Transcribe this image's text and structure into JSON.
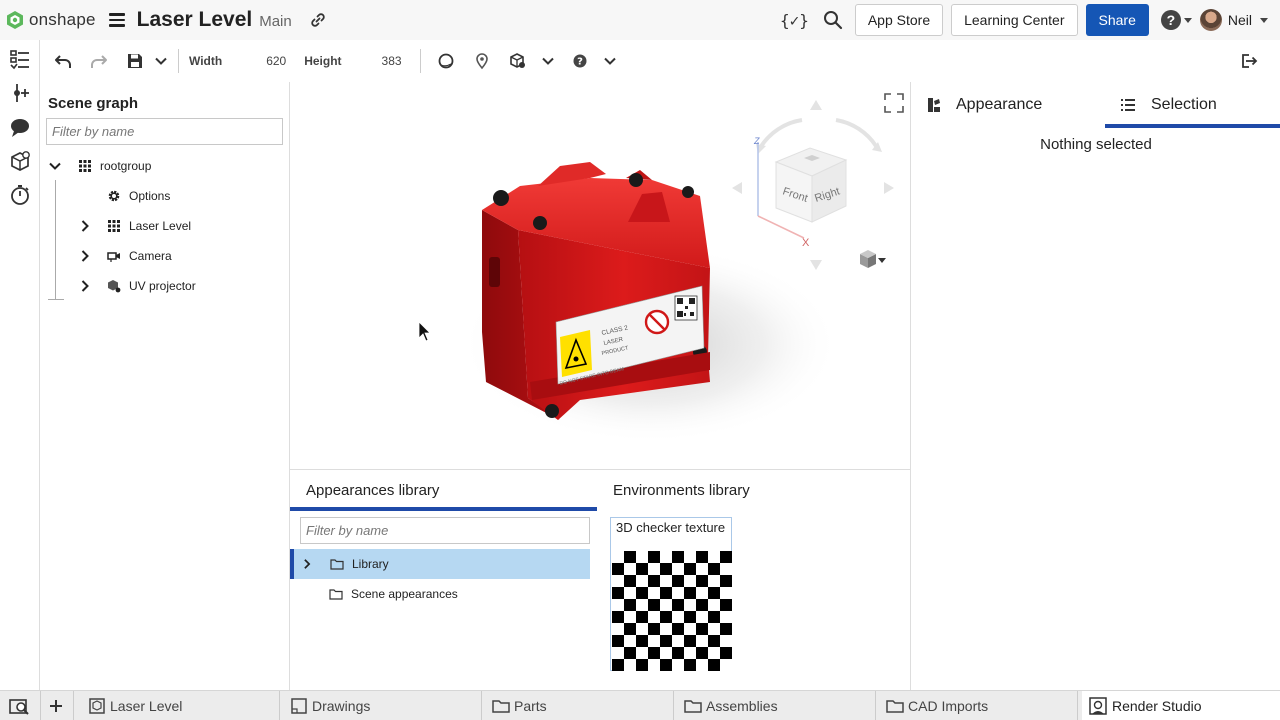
{
  "app": {
    "logo_text": "onshape",
    "document_title": "Laser Level",
    "branch": "Main"
  },
  "topbar": {
    "variable_icon_text": "{✓}",
    "app_store_label": "App Store",
    "learning_center_label": "Learning Center",
    "share_label": "Share",
    "help_glyph": "?",
    "user_name": "Neil"
  },
  "toolbar": {
    "width_label": "Width",
    "width_value": "620",
    "height_label": "Height",
    "height_value": "383"
  },
  "scene_graph": {
    "title": "Scene graph",
    "filter_placeholder": "Filter by name",
    "items": [
      {
        "label": "rootgroup",
        "icon": "grid-icon",
        "expander": "chevron-down-icon"
      },
      {
        "label": "Options",
        "icon": "gear-icon",
        "expander": ""
      },
      {
        "label": "Laser Level",
        "icon": "grid-icon",
        "expander": "chevron-right-icon"
      },
      {
        "label": "Camera",
        "icon": "camera-icon",
        "expander": "chevron-right-icon"
      },
      {
        "label": "UV projector",
        "icon": "projector-icon",
        "expander": "chevron-right-icon"
      }
    ]
  },
  "viewport": {
    "view_cube_front": "Front",
    "view_cube_right": "Right",
    "axis_x": "X",
    "axis_z": "Z",
    "label_class": "CLASS 2",
    "label_laser": "LASER",
    "label_product": "PRODUCT",
    "label_warning": "DO NOT STARE INTO BEAM"
  },
  "right_panel": {
    "tab_appearance": "Appearance",
    "tab_selection": "Selection",
    "empty_message": "Nothing selected"
  },
  "libraries": {
    "appearances_tab": "Appearances library",
    "environments_tab": "Environments library",
    "filter_placeholder": "Filter by name",
    "rows": [
      {
        "label": "Library",
        "selected": true
      },
      {
        "label": "Scene appearances",
        "selected": false
      }
    ],
    "environment_label": "3D checker texture"
  },
  "bottom_tabs": [
    {
      "label": "Laser Level",
      "icon": "part-studio-icon"
    },
    {
      "label": "Drawings",
      "icon": "drawing-icon"
    },
    {
      "label": "Parts",
      "icon": "folder-icon"
    },
    {
      "label": "Assemblies",
      "icon": "folder-icon"
    },
    {
      "label": "CAD Imports",
      "icon": "folder-icon"
    },
    {
      "label": "Render Studio",
      "icon": "render-studio-icon",
      "active": true
    }
  ],
  "colors": {
    "accent_blue": "#1f4aa8",
    "share_blue": "#1556b5",
    "selection_bg": "#b6d8f2",
    "product_red": "#d01818",
    "logo_green": "#5cb85c"
  }
}
